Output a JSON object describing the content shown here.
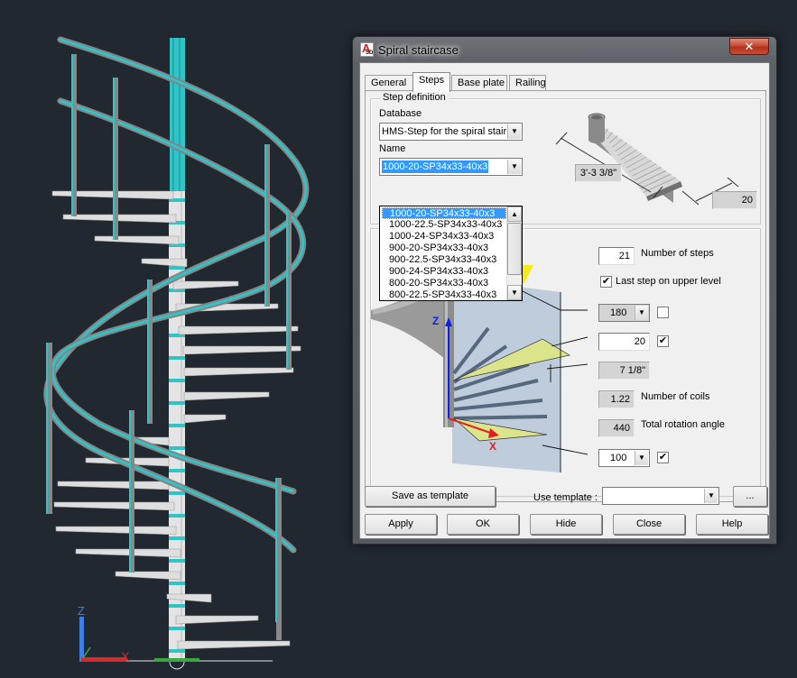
{
  "viewport": {
    "background": "#212830",
    "ucs": {
      "z_label": "Z",
      "x_label": "X"
    },
    "colors": {
      "rail": "#2ec4c8",
      "metal": "#8b8b8b",
      "step": "#e6e6e6",
      "accent_green": "#1db53b"
    }
  },
  "dialog": {
    "title": "Spiral staircase",
    "app_icon": {
      "letter": "A",
      "sub": "SD"
    },
    "close_glyph": "✕",
    "tabs": [
      {
        "label": "General",
        "active": false
      },
      {
        "label": "Steps",
        "active": true
      },
      {
        "label": "Base plate",
        "active": false
      },
      {
        "label": "Railing",
        "active": false
      }
    ],
    "step_definition": {
      "title": "Step definition",
      "database_label": "Database",
      "database_value": "HMS-Step for the spiral stair",
      "name_label": "Name",
      "name_value": "1000-20-SP34x33-40x3",
      "name_options": [
        "1000-20-SP34x33-40x3",
        "1000-22.5-SP34x33-40x3",
        "1000-24-SP34x33-40x3",
        "900-20-SP34x33-40x3",
        "900-22.5-SP34x33-40x3",
        "900-24-SP34x33-40x3",
        "800-20-SP34x33-40x3",
        "800-22.5-SP34x33-40x3"
      ],
      "highlighted_index": 0,
      "preview": {
        "length_value": "3'-3 3/8\"",
        "width_value": "20"
      }
    },
    "steps": {
      "number_of_steps_value": "21",
      "number_of_steps_label": "Number of steps",
      "last_step_upper_label": "Last step on upper level",
      "last_step_upper_checked": true,
      "start_angle_value": "180",
      "start_angle_checked": false,
      "step_angle_value": "20",
      "step_angle_checked": true,
      "riser_height_value": "7 1/8\"",
      "coils_value": "1.22",
      "coils_label": "Number of coils",
      "rotation_value": "440",
      "rotation_label": "Total rotation angle",
      "bottom_value": "100",
      "bottom_checked": true,
      "diagram_axes": {
        "z": "Z",
        "x": "X"
      }
    },
    "footer": {
      "save_template": "Save as template",
      "use_template_label": "Use template :",
      "use_template_value": "",
      "browse": "...",
      "apply": "Apply",
      "ok": "OK",
      "hide": "Hide",
      "close": "Close",
      "help": "Help"
    }
  }
}
